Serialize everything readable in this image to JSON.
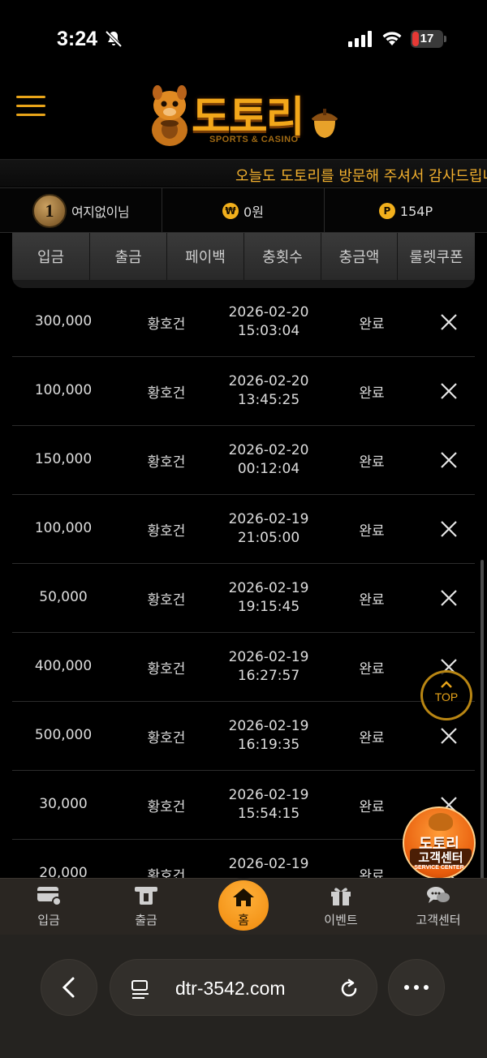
{
  "status_bar": {
    "time": "3:24",
    "battery": "17"
  },
  "logo": {
    "word": "도토리",
    "sub": "SPORTS & CASINO"
  },
  "ticker": "오늘도 도토리를 방문해 주셔서 감사드립니다",
  "user": {
    "level": "1",
    "name": "여지없이님",
    "money_symbol": "₩",
    "money": "0원",
    "point_symbol": "P",
    "point": "154P"
  },
  "tabs": [
    {
      "label": "입금"
    },
    {
      "label": "출금"
    },
    {
      "label": "페이백"
    },
    {
      "label": "충횟수"
    },
    {
      "label": "충금액"
    },
    {
      "label": "룰렛쿠폰"
    }
  ],
  "rows": [
    {
      "amount": "300,000",
      "name": "황호건",
      "date": "2026-02-20",
      "time": "15:03:04",
      "status": "완료"
    },
    {
      "amount": "100,000",
      "name": "황호건",
      "date": "2026-02-20",
      "time": "13:45:25",
      "status": "완료"
    },
    {
      "amount": "150,000",
      "name": "황호건",
      "date": "2026-02-20",
      "time": "00:12:04",
      "status": "완료"
    },
    {
      "amount": "100,000",
      "name": "황호건",
      "date": "2026-02-19",
      "time": "21:05:00",
      "status": "완료"
    },
    {
      "amount": "50,000",
      "name": "황호건",
      "date": "2026-02-19",
      "time": "19:15:45",
      "status": "완료"
    },
    {
      "amount": "400,000",
      "name": "황호건",
      "date": "2026-02-19",
      "time": "16:27:57",
      "status": "완료"
    },
    {
      "amount": "500,000",
      "name": "황호건",
      "date": "2026-02-19",
      "time": "16:19:35",
      "status": "완료"
    },
    {
      "amount": "30,000",
      "name": "황호건",
      "date": "2026-02-19",
      "time": "15:54:15",
      "status": "완료"
    },
    {
      "amount": "20,000",
      "name": "황호건",
      "date": "2026-02-19",
      "time": "",
      "status": "완료"
    }
  ],
  "float": {
    "top_label": "TOP",
    "cs_title": "도토리",
    "cs_label": "고객센터",
    "cs_sub": "SERVICE CENTER"
  },
  "bottom_nav": {
    "deposit": "입금",
    "withdraw": "출금",
    "home": "홈",
    "event": "이벤트",
    "support": "고객센터"
  },
  "browser": {
    "url": "dtr-3542.com"
  },
  "colors": {
    "accent": "#e8a419",
    "background": "#000000",
    "nav_bg": "#2a2622"
  }
}
